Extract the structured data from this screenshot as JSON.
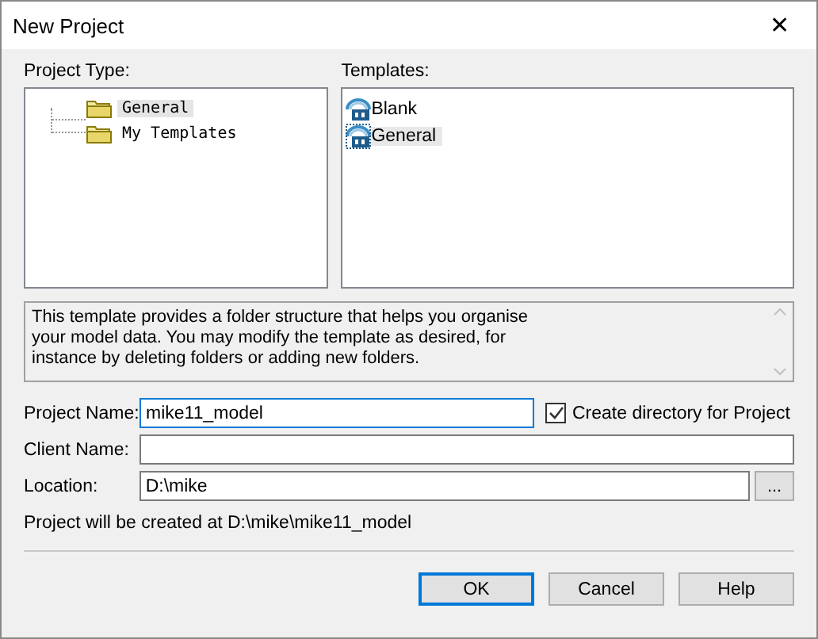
{
  "window": {
    "title": "New Project",
    "close": "✕"
  },
  "project_type": {
    "label": "Project Type:",
    "items": [
      {
        "label": "General",
        "selected": true
      },
      {
        "label": "My Templates",
        "selected": false
      }
    ]
  },
  "templates": {
    "label": "Templates:",
    "items": [
      {
        "label": "Blank",
        "selected": false
      },
      {
        "label": "General",
        "selected": true
      }
    ]
  },
  "description": "This template provides a folder structure that helps you organise\nyour model data. You may modify the template as desired, for\ninstance by deleting folders or adding new folders.",
  "fields": [
    {
      "label": "Project Name:",
      "value": "mike11_model",
      "focused": true
    },
    {
      "label": "Client Name:",
      "focused": false
    },
    {
      "label": "Location:",
      "value": "D:\\mike",
      "focused": false
    }
  ],
  "create_directory": {
    "label": "Create directory for Project",
    "checked": true
  },
  "browse_button": "...",
  "info": "Project will be created at D:\\mike\\mike11_model",
  "buttons": [
    {
      "label": "OK",
      "default": true
    },
    {
      "label": "Cancel",
      "default": false
    },
    {
      "label": "Help",
      "default": false
    }
  ]
}
